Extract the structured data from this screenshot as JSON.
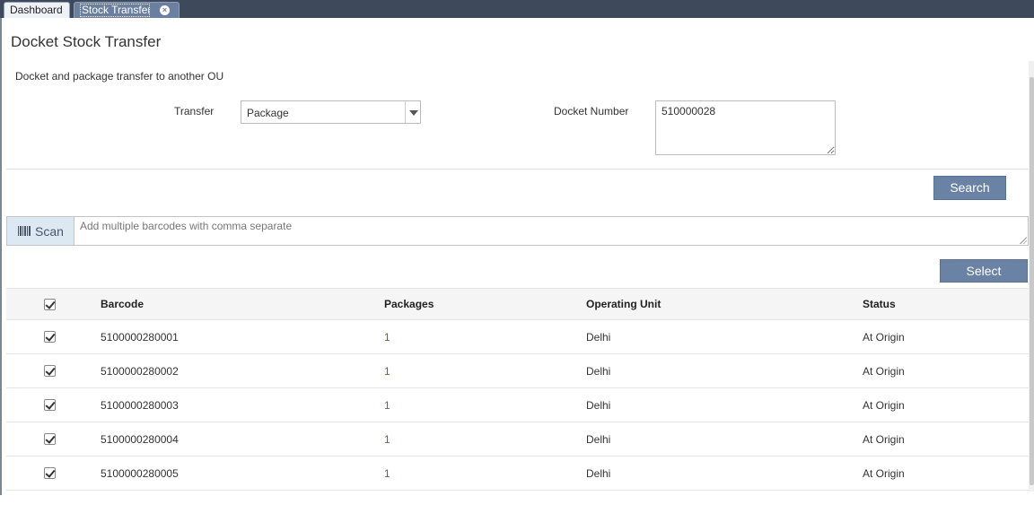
{
  "tabs": [
    {
      "label": "Dashboard"
    },
    {
      "label": "Stock Transfer"
    }
  ],
  "page": {
    "title": "Docket Stock Transfer",
    "subtitle": "Docket and package transfer to another OU"
  },
  "form": {
    "transfer_label": "Transfer",
    "transfer_value": "Package",
    "docket_label": "Docket Number",
    "docket_value": "510000028",
    "search_button": "Search"
  },
  "scan": {
    "button_label": "Scan",
    "placeholder": "Add multiple barcodes with comma separate",
    "select_button": "Select"
  },
  "table": {
    "headers": {
      "barcode": "Barcode",
      "packages": "Packages",
      "operating_unit": "Operating Unit",
      "status": "Status"
    },
    "rows": [
      {
        "barcode": "5100000280001",
        "packages": "1",
        "operating_unit": "Delhi",
        "status": "At Origin"
      },
      {
        "barcode": "5100000280002",
        "packages": "1",
        "operating_unit": "Delhi",
        "status": "At Origin"
      },
      {
        "barcode": "5100000280003",
        "packages": "1",
        "operating_unit": "Delhi",
        "status": "At Origin"
      },
      {
        "barcode": "5100000280004",
        "packages": "1",
        "operating_unit": "Delhi",
        "status": "At Origin"
      },
      {
        "barcode": "5100000280005",
        "packages": "1",
        "operating_unit": "Delhi",
        "status": "At Origin"
      }
    ]
  },
  "colors": {
    "header_bar": "#3e4a5c",
    "button": "#6a82a3",
    "scan_bg": "#dce9f3",
    "package_count": "#4a7a3a"
  },
  "icons": {
    "tab_close": "close-circle-icon",
    "scan": "barcode-icon",
    "dropdown": "caret-down-icon",
    "checkbox": "check-icon"
  }
}
